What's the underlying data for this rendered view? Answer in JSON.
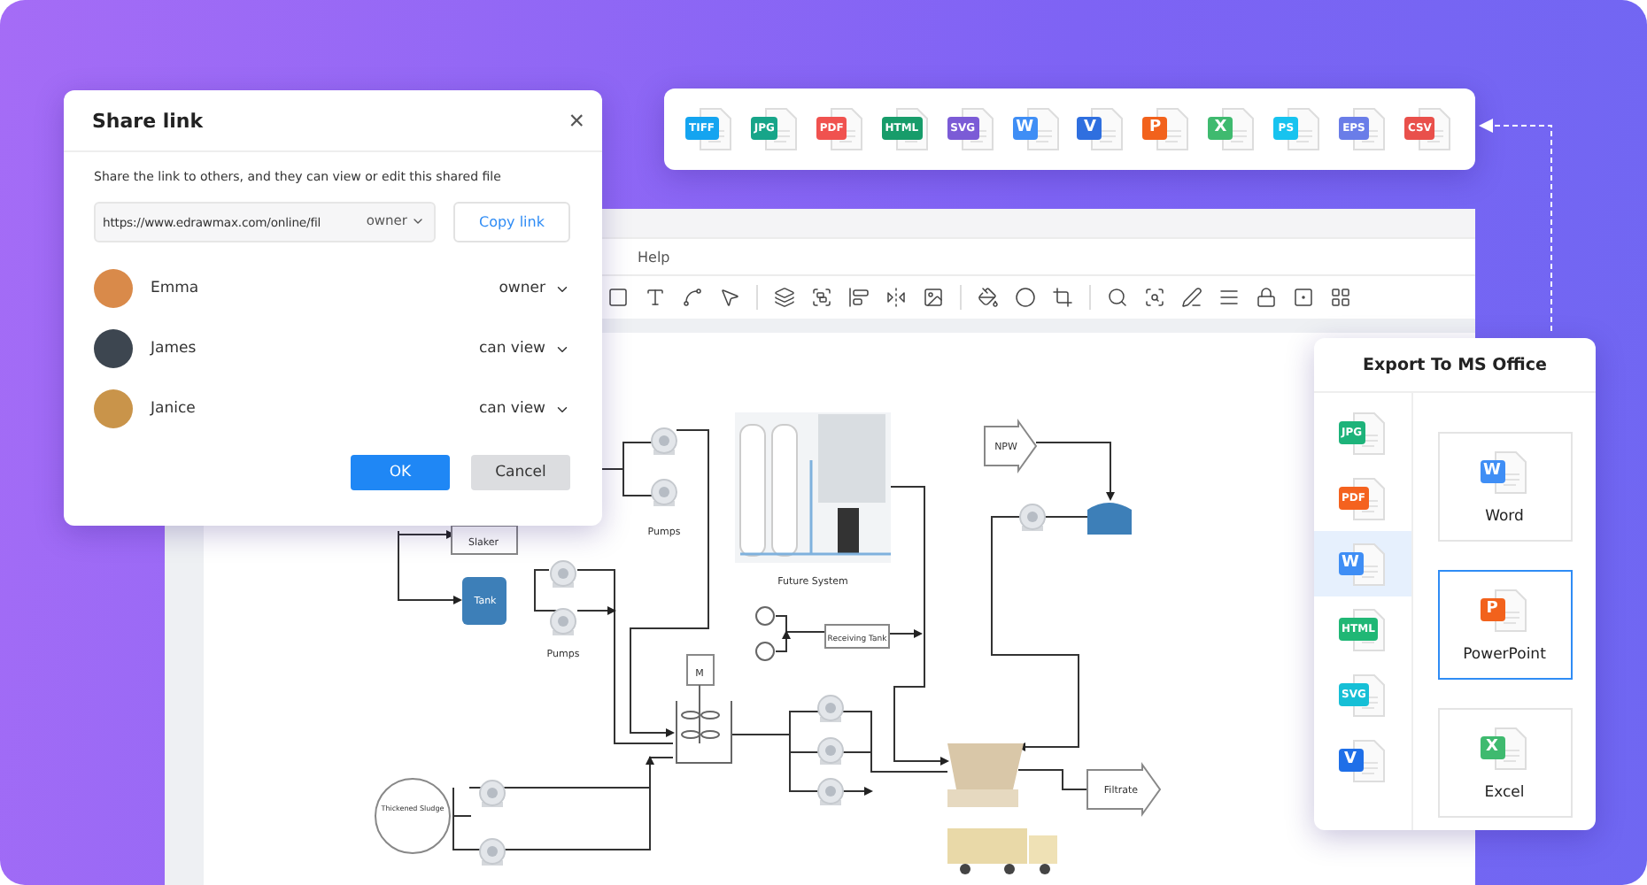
{
  "format_bar": [
    {
      "label": "TIFF",
      "color": "#14a4f0"
    },
    {
      "label": "JPG",
      "color": "#17a589"
    },
    {
      "label": "PDF",
      "color": "#f0524f"
    },
    {
      "label": "HTML",
      "color": "#179c6a"
    },
    {
      "label": "SVG",
      "color": "#7b5bd6"
    },
    {
      "label": "W",
      "color": "#3f8ef5"
    },
    {
      "label": "V",
      "color": "#2f6fdf"
    },
    {
      "label": "P",
      "color": "#f2621c"
    },
    {
      "label": "X",
      "color": "#3fba6f"
    },
    {
      "label": "PS",
      "color": "#17c3ef"
    },
    {
      "label": "EPS",
      "color": "#6a7de8"
    },
    {
      "label": "CSV",
      "color": "#e9504b"
    }
  ],
  "editor": {
    "menu": [
      "Help"
    ]
  },
  "diagram": {
    "labels": [
      {
        "text": "Slaker"
      },
      {
        "text": "Tank"
      },
      {
        "text": "Pumps"
      },
      {
        "text": "Pumps"
      },
      {
        "text": "Future System"
      },
      {
        "text": "NPW"
      },
      {
        "text": "Receiving Tank"
      },
      {
        "text": "M"
      },
      {
        "text": "Thickened Sludge"
      },
      {
        "text": "Filtrate"
      }
    ]
  },
  "share_dialog": {
    "title": "Share link",
    "close": "×",
    "description": "Share the link to others, and they can view or edit this shared file",
    "link": {
      "value": "https://www.edrawmax.com/online/fil",
      "permission": "owner"
    },
    "copy_button": "Copy link",
    "users": [
      {
        "name": "Emma",
        "role": "owner"
      },
      {
        "name": "James",
        "role": "can view"
      },
      {
        "name": "Janice",
        "role": "can view"
      }
    ],
    "buttons": [
      {
        "label": "OK",
        "kind": "primary"
      },
      {
        "label": "Cancel",
        "kind": "secondary"
      }
    ]
  },
  "export_panel": {
    "title": "Export To MS Office",
    "formats": [
      {
        "label": "JPG",
        "color": "#1db37a",
        "selected": false
      },
      {
        "label": "PDF",
        "color": "#f4621f",
        "selected": false
      },
      {
        "label": "W",
        "color": "#3f8ef5",
        "selected": true
      },
      {
        "label": "HTML",
        "color": "#20b775",
        "selected": false
      },
      {
        "label": "SVG",
        "color": "#16bfd6",
        "selected": false
      },
      {
        "label": "V",
        "color": "#1f6fe8",
        "selected": false
      }
    ],
    "options": [
      {
        "name": "Word",
        "badge": "W",
        "color": "#3f8ef5",
        "selected": false
      },
      {
        "name": "PowerPoint",
        "badge": "P",
        "color": "#f2621c",
        "selected": true
      },
      {
        "name": "Excel",
        "badge": "X",
        "color": "#3fba6f",
        "selected": false
      }
    ]
  }
}
